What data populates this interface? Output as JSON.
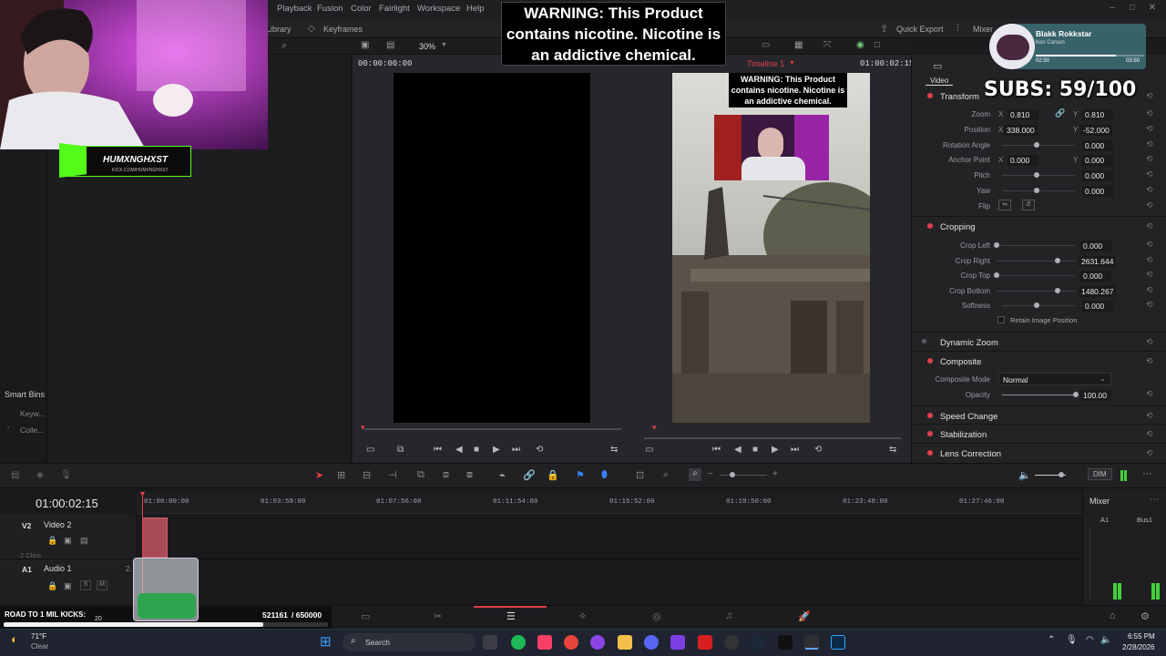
{
  "menu": {
    "items": [
      "Playback",
      "Fusion",
      "Color",
      "Fairlight",
      "Workspace",
      "Help"
    ]
  },
  "toolbar": {
    "library": "Library",
    "keyframes": "Keyframes",
    "zoom": "30%",
    "quick_export": "Quick Export",
    "mixer": "Mixer",
    "multiple": "Multipl",
    "file": "File"
  },
  "viewer": {
    "source_tc": "00:00:00:00",
    "timeline_name": "Timeline 1",
    "timeline_tc": "01:00:02:15",
    "warning": "WARNING: This Product contains nicotine. Nicotine is an addictive chemical."
  },
  "overlay": {
    "warning": "WARNING: This Product contains nicotine. Nicotine is an addictive chemical.",
    "subs": "SUBS: 59/100",
    "streamer_name": "HUMXNGHXST",
    "streamer_url": "KICK.COM/HUMXNGHXST",
    "goal_label": "ROAD TO 1 MIL KICKS:",
    "goal_sub": "20",
    "goal_value": "521161",
    "goal_total": "/ 650000",
    "goal_progress": 0.8018
  },
  "spotify": {
    "title": "Blakk Rokkstar",
    "artist": "Ken Carson",
    "elapsed": "02:50",
    "duration": "03:50",
    "progress": 0.74
  },
  "smart_bins": {
    "title": "Smart Bins",
    "items": [
      "Keyw...",
      "Colle..."
    ]
  },
  "inspector": {
    "tab_video": "Video",
    "transform": {
      "title": "Transform",
      "zoom_label": "Zoom",
      "zoom_x": "0.810",
      "zoom_y": "0.810",
      "position_label": "Position",
      "position_x": "338.000",
      "position_y": "-52.000",
      "rotation_label": "Rotation Angle",
      "rotation": "0.000",
      "anchor_label": "Anchor Point",
      "anchor_x": "0.000",
      "anchor_y": "0.000",
      "pitch_label": "Pitch",
      "pitch": "0.000",
      "yaw_label": "Yaw",
      "yaw": "0.000",
      "flip_label": "Flip",
      "axis_x": "X",
      "axis_y": "Y"
    },
    "cropping": {
      "title": "Cropping",
      "left_label": "Crop Left",
      "left": "0.000",
      "right_label": "Crop Right",
      "right": "2631.644",
      "top_label": "Crop Top",
      "top": "0.000",
      "bottom_label": "Crop Bottom",
      "bottom": "1480.267",
      "soft_label": "Softness",
      "soft": "0.000",
      "retain": "Retain Image Position"
    },
    "dynamic_zoom": "Dynamic Zoom",
    "composite": {
      "title": "Composite",
      "mode_label": "Composite Mode",
      "mode": "Normal",
      "opacity_label": "Opacity",
      "opacity": "100.00"
    },
    "speed_change": "Speed Change",
    "stabilization": "Stabilization",
    "lens_correction": "Lens Correction"
  },
  "timeline": {
    "timecode": "01:00:02:15",
    "ruler": [
      "01:00:00:00",
      "01:03:58:00",
      "01:07:56:00",
      "01:11:54:00",
      "01:15:52:00",
      "01:19:50:00",
      "01:23:48:00",
      "01:27:46:00"
    ],
    "v2_id": "V2",
    "v2_name": "Video 2",
    "v2_clips": "2 Clips",
    "a1_id": "A1",
    "a1_name": "Audio 1",
    "a1_s": "S",
    "a1_m": "M",
    "a1_num": "2."
  },
  "mixer": {
    "title": "Mixer",
    "ch1": "A1",
    "ch2": "Bus1",
    "dim": "DIM"
  },
  "taskbar": {
    "weather_temp": "71°F",
    "weather_text": "Clear",
    "search": "Search",
    "time": "6:55 PM",
    "date": "2/28/2026"
  },
  "colors": {
    "accent_red": "#e0404a",
    "kick_green": "#53fc18"
  }
}
